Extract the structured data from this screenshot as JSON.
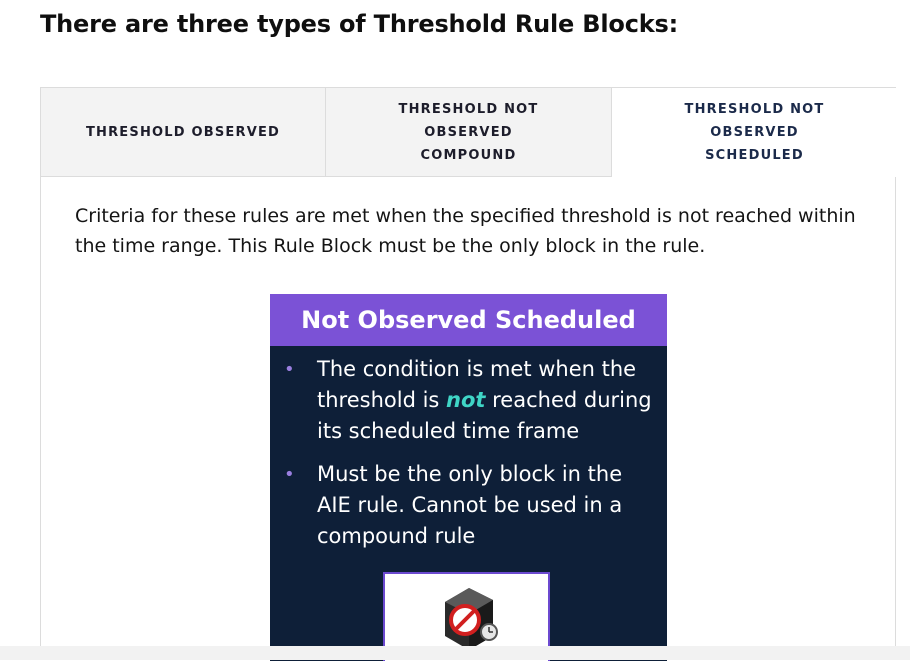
{
  "page": {
    "heading": "There are three types of Threshold Rule Blocks:"
  },
  "tabs": [
    {
      "label": "THRESHOLD OBSERVED",
      "active": false
    },
    {
      "label": "THRESHOLD NOT OBSERVED\nCOMPOUND",
      "active": false
    },
    {
      "label": "THRESHOLD NOT OBSERVED\nSCHEDULED",
      "active": true
    }
  ],
  "content": {
    "description": "Criteria for these rules are met when the specified threshold is not reached within the time range. This Rule Block must be the only block in the rule.",
    "slide": {
      "title": "Not Observed Scheduled",
      "bullet_symbol": "•",
      "bullets": [
        {
          "before": "The condition is met when the threshold is ",
          "emphasis": "not",
          "after": " reached during its scheduled time frame"
        },
        {
          "text": "Must be the only block in the AIE rule. Cannot be used in a compound rule"
        }
      ],
      "icon": "scheduled-rule-icon"
    }
  },
  "colors": {
    "slide_background": "#0e1f38",
    "slide_title_background": "#7b52d6",
    "emphasis": "#3fd5c6",
    "tab_inactive_background": "#f3f3f3"
  }
}
